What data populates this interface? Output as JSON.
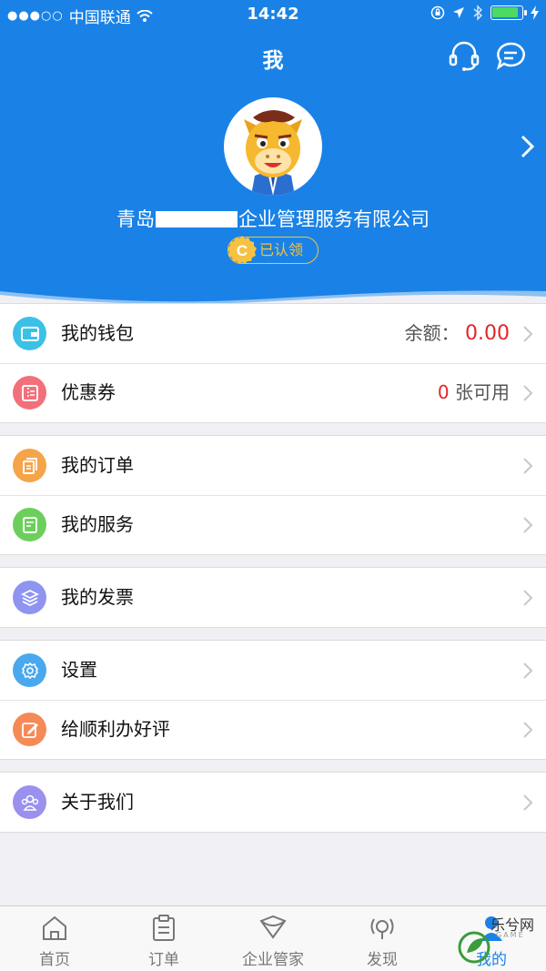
{
  "status_bar": {
    "signal": "●●●○○",
    "carrier": "中国联通",
    "time": "14:42",
    "battery_level": 0.9
  },
  "header": {
    "title": "我",
    "company_prefix": "青岛",
    "company_suffix": "企业管理服务有限公司",
    "badge_letter": "C",
    "badge_text": "已认领",
    "bg_color": "#1a82e6"
  },
  "menu": {
    "wallet": {
      "label": "我的钱包",
      "value_label": "余额：",
      "value": "0.00",
      "icon": "wallet-icon",
      "color": "#3cc1e6"
    },
    "coupon": {
      "label": "优惠券",
      "count": "0",
      "count_suffix": "张可用",
      "icon": "coupon-icon",
      "color": "#f2707a"
    },
    "orders": {
      "label": "我的订单",
      "icon": "order-icon",
      "color": "#f5a44a"
    },
    "services": {
      "label": "我的服务",
      "icon": "service-icon",
      "color": "#6ccf5c"
    },
    "invoice": {
      "label": "我的发票",
      "icon": "layers-icon",
      "color": "#8f94f0"
    },
    "settings": {
      "label": "设置",
      "icon": "gear-icon",
      "color": "#4aa8ee"
    },
    "review": {
      "label": "给顺利办好评",
      "icon": "edit-icon",
      "color": "#f58a57"
    },
    "about": {
      "label": "关于我们",
      "icon": "people-icon",
      "color": "#9a90ee"
    }
  },
  "tabbar": {
    "tabs": [
      {
        "label": "首页",
        "icon": "home-icon"
      },
      {
        "label": "订单",
        "icon": "clipboard-icon"
      },
      {
        "label": "企业管家",
        "icon": "diamond-icon"
      },
      {
        "label": "发现",
        "icon": "broadcast-icon"
      },
      {
        "label": "我的",
        "icon": "user-icon"
      }
    ],
    "active_color": "#1a82e6"
  },
  "watermark": {
    "text": "乐兮网",
    "sub": "GAME"
  }
}
